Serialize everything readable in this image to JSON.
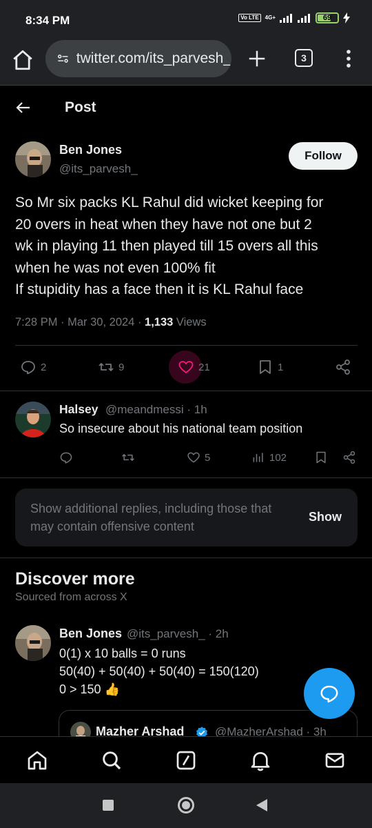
{
  "status_bar": {
    "time": "8:34 PM",
    "volte": "Vo LTE",
    "network": "4G+",
    "battery": "69",
    "battery_level": 0.69
  },
  "browser": {
    "url": "twitter.com/its_parvesh_",
    "tab_count": "3"
  },
  "header": {
    "title": "Post"
  },
  "tweet": {
    "author_name": "Ben Jones",
    "author_handle": "@its_parvesh_",
    "follow_label": "Follow",
    "text_lines": [
      "So Mr six packs KL Rahul did wicket keeping for",
      "20 overs in heat when they have not one but 2",
      "wk in playing 11 then played till 15 overs all this",
      "when he was not even 100% fit",
      "If stupidity has a face then it is KL Rahul face"
    ],
    "time": "7:28 PM",
    "date": "Mar 30, 2024",
    "views_count": "1,133",
    "views_label": "Views",
    "replies": "2",
    "retweets": "9",
    "likes": "21",
    "bookmarks": "1"
  },
  "reply": {
    "name": "Halsey",
    "handle": "@meandmessi",
    "age": "1h",
    "text": "So insecure about his national team position",
    "likes": "5",
    "views": "102"
  },
  "hidden_replies": {
    "text": "Show additional replies, including those that may contain offensive content",
    "button": "Show"
  },
  "discover": {
    "title": "Discover more",
    "subtitle": "Sourced from across X",
    "post": {
      "name": "Ben Jones",
      "handle": "@its_parvesh_",
      "age": "2h",
      "line1": "0(1) x 10 balls = 0 runs",
      "line2": "50(40) + 50(40) + 50(40) = 150(120)",
      "line3": "0 > 150 👍"
    },
    "quote": {
      "name": "Mazher Arshad",
      "handle": "@MazherArshad",
      "age": "3h"
    }
  },
  "icons": {
    "nav": [
      "home-icon",
      "search-icon",
      "grok-icon",
      "notifications-icon",
      "messages-icon"
    ],
    "accent": "#1d9bf0",
    "like_color": "#f91880",
    "verified_color": "#1d9bf0"
  }
}
